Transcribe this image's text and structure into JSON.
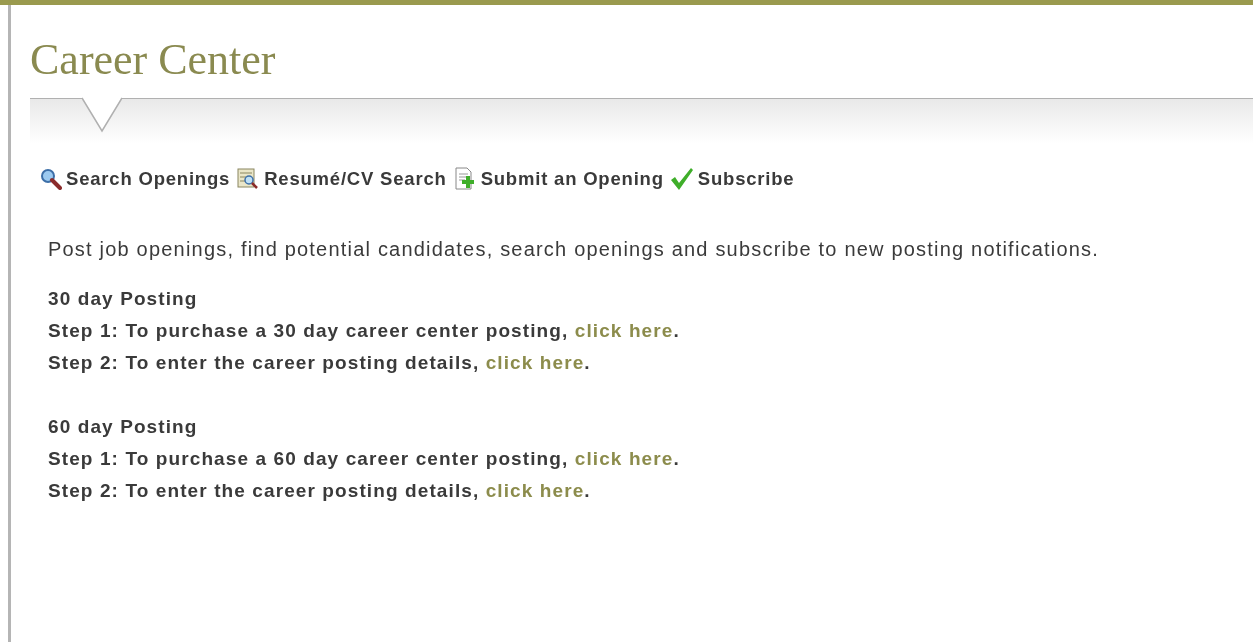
{
  "page": {
    "title": "Career Center"
  },
  "toolbar": [
    {
      "kind": "search",
      "label": "Search Openings"
    },
    {
      "kind": "resume",
      "label": "Resumé/CV Search"
    },
    {
      "kind": "submit",
      "label": "Submit an Opening"
    },
    {
      "kind": "subscribe",
      "label": "Subscribe"
    }
  ],
  "intro": "Post job openings, find potential candidates, search openings and subscribe to new posting notifications.",
  "sections": [
    {
      "heading": "30 day Posting",
      "steps": [
        {
          "text": "Step 1: To purchase a 30 day career center posting, ",
          "link": "click here",
          "end": "."
        },
        {
          "text": "Step 2: To enter the career posting details, ",
          "link": "click here",
          "end": "."
        }
      ]
    },
    {
      "heading": "60 day Posting",
      "steps": [
        {
          "text": "Step 1: To purchase a 60 day career center posting, ",
          "link": "click here",
          "end": "."
        },
        {
          "text": "Step 2: To enter the career posting details, ",
          "link": "click here",
          "end": "."
        }
      ]
    }
  ]
}
